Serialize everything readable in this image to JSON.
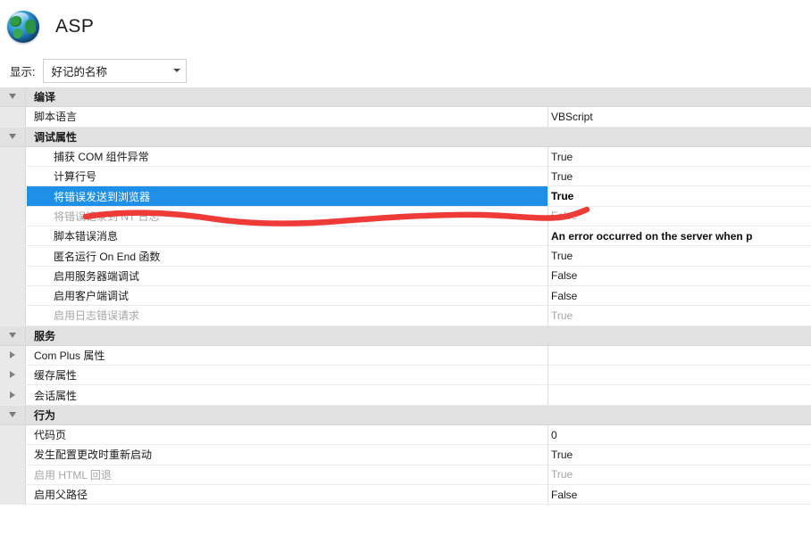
{
  "window": {
    "title": "ASP",
    "icon": "globe-icon"
  },
  "filter_bar": {
    "label": "显示:",
    "combo_value": "好记的名称",
    "arrow_icon": "chevron-down-icon"
  },
  "grid": {
    "rows": [
      {
        "type": "group",
        "label": "编译",
        "value": "",
        "expander": "expanded",
        "state": "normal"
      },
      {
        "type": "item",
        "label": "脚本语言",
        "value": "VBScript",
        "expander": "none",
        "state": "normal"
      },
      {
        "type": "group",
        "label": "调试属性",
        "value": "",
        "expander": "expanded",
        "state": "normal"
      },
      {
        "type": "child",
        "label": "捕获 COM 组件异常",
        "value": "True",
        "expander": "none",
        "state": "normal"
      },
      {
        "type": "child",
        "label": "计算行号",
        "value": "True",
        "expander": "none",
        "state": "normal"
      },
      {
        "type": "child",
        "label": "将错误发送到浏览器",
        "value": "True",
        "expander": "none",
        "state": "selected"
      },
      {
        "type": "child",
        "label": "将错误记录到 NT 日志",
        "value": "False",
        "expander": "none",
        "state": "disabled"
      },
      {
        "type": "child",
        "label": "脚本错误消息",
        "value": "An error occurred on the server when p",
        "expander": "none",
        "state": "bold"
      },
      {
        "type": "child",
        "label": "匿名运行 On End 函数",
        "value": "True",
        "expander": "none",
        "state": "normal"
      },
      {
        "type": "child",
        "label": "启用服务器端调试",
        "value": "False",
        "expander": "none",
        "state": "normal"
      },
      {
        "type": "child",
        "label": "启用客户端调试",
        "value": "False",
        "expander": "none",
        "state": "normal"
      },
      {
        "type": "child",
        "label": "启用日志错误请求",
        "value": "True",
        "expander": "none",
        "state": "disabled"
      },
      {
        "type": "group",
        "label": "服务",
        "value": "",
        "expander": "expanded",
        "state": "normal"
      },
      {
        "type": "item",
        "label": "Com Plus 属性",
        "value": "",
        "expander": "collapsed",
        "state": "normal"
      },
      {
        "type": "item",
        "label": "缓存属性",
        "value": "",
        "expander": "collapsed",
        "state": "normal"
      },
      {
        "type": "item",
        "label": "会话属性",
        "value": "",
        "expander": "collapsed",
        "state": "normal"
      },
      {
        "type": "group",
        "label": "行为",
        "value": "",
        "expander": "expanded",
        "state": "normal"
      },
      {
        "type": "item",
        "label": "代码页",
        "value": "0",
        "expander": "none",
        "state": "normal"
      },
      {
        "type": "item",
        "label": "发生配置更改时重新启动",
        "value": "True",
        "expander": "none",
        "state": "normal"
      },
      {
        "type": "item",
        "label": "启用 HTML 回退",
        "value": "True",
        "expander": "none",
        "state": "disabled"
      },
      {
        "type": "item",
        "label": "启用父路径",
        "value": "False",
        "expander": "none",
        "state": "normal"
      }
    ]
  },
  "annotation": {
    "type": "freehand-underline",
    "color": "#ef3b38"
  },
  "colors": {
    "selection": "#1e90e8",
    "group_header_bg": "#e2e1e1",
    "gutter_bg": "#e9e9e9",
    "annotation_red": "#ef3b38",
    "disabled_text": "#a6a6a6"
  }
}
